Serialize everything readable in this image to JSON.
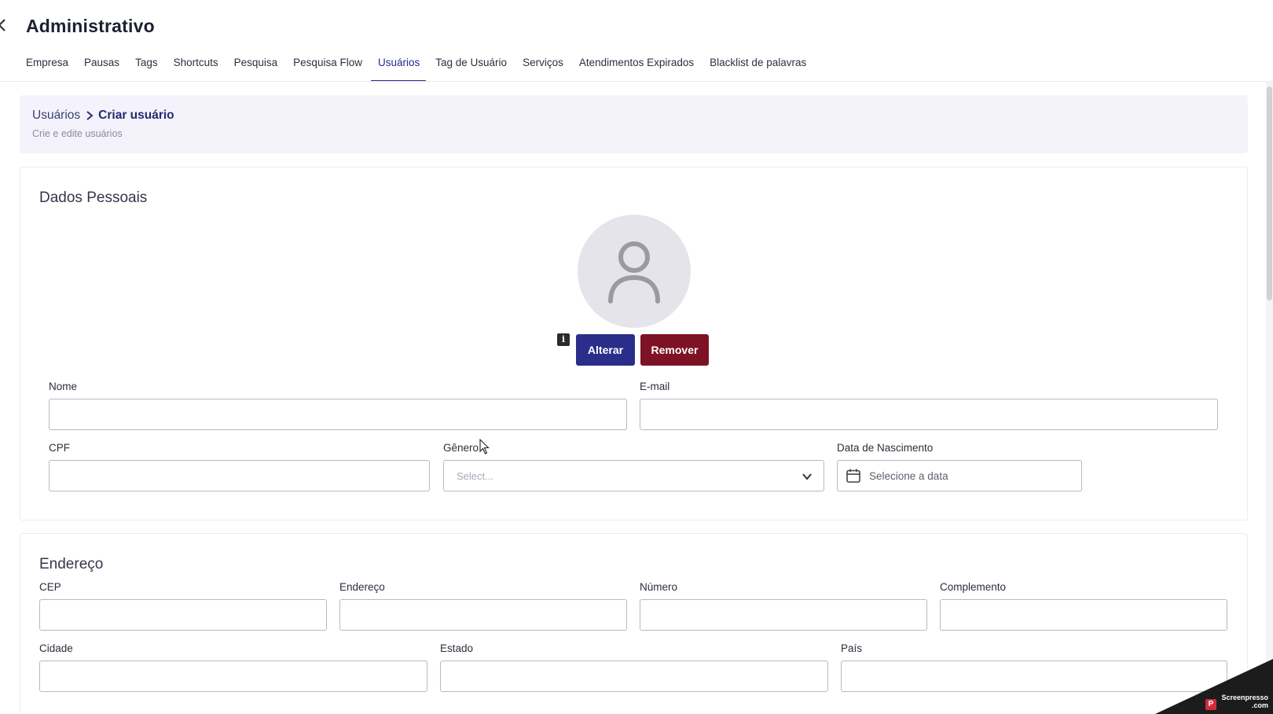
{
  "page": {
    "title": "Administrativo"
  },
  "tabs": [
    {
      "label": "Empresa"
    },
    {
      "label": "Pausas"
    },
    {
      "label": "Tags"
    },
    {
      "label": "Shortcuts"
    },
    {
      "label": "Pesquisa"
    },
    {
      "label": "Pesquisa Flow"
    },
    {
      "label": "Usuários",
      "active": true
    },
    {
      "label": "Tag de Usuário"
    },
    {
      "label": "Serviços"
    },
    {
      "label": "Atendimentos Expirados"
    },
    {
      "label": "Blacklist de palavras"
    }
  ],
  "header": {
    "breadcrumb_parent": "Usuários",
    "breadcrumb_current": "Criar usuário",
    "subtitle": "Crie e edite usuários"
  },
  "personal": {
    "title": "Dados Pessoais",
    "info_icon": "i",
    "alterar_label": "Alterar",
    "remover_label": "Remover",
    "nome_label": "Nome",
    "nome_value": "",
    "email_label": "E-mail",
    "email_value": "",
    "cpf_label": "CPF",
    "cpf_value": "",
    "genero_label": "Gênero",
    "genero_placeholder": "Select...",
    "nascimento_label": "Data de Nascimento",
    "nascimento_placeholder": "Selecione a data"
  },
  "address": {
    "title": "Endereço",
    "cep_label": "CEP",
    "endereco_label": "Endereço",
    "numero_label": "Número",
    "complemento_label": "Complemento",
    "cidade_label": "Cidade",
    "estado_label": "Estado",
    "pais_label": "País"
  },
  "watermark": {
    "logo": "P",
    "line1": "Screenpresso",
    "line2": ".com"
  },
  "colors": {
    "primary": "#2a2e8a",
    "danger": "#7e1225",
    "header_bg": "#f4f3fc"
  },
  "icons": {
    "back": "chevron-left-icon",
    "breadcrumb_sep": "chevron-right-icon",
    "avatar": "user-icon",
    "select": "chevron-down-icon",
    "date": "calendar-icon"
  }
}
